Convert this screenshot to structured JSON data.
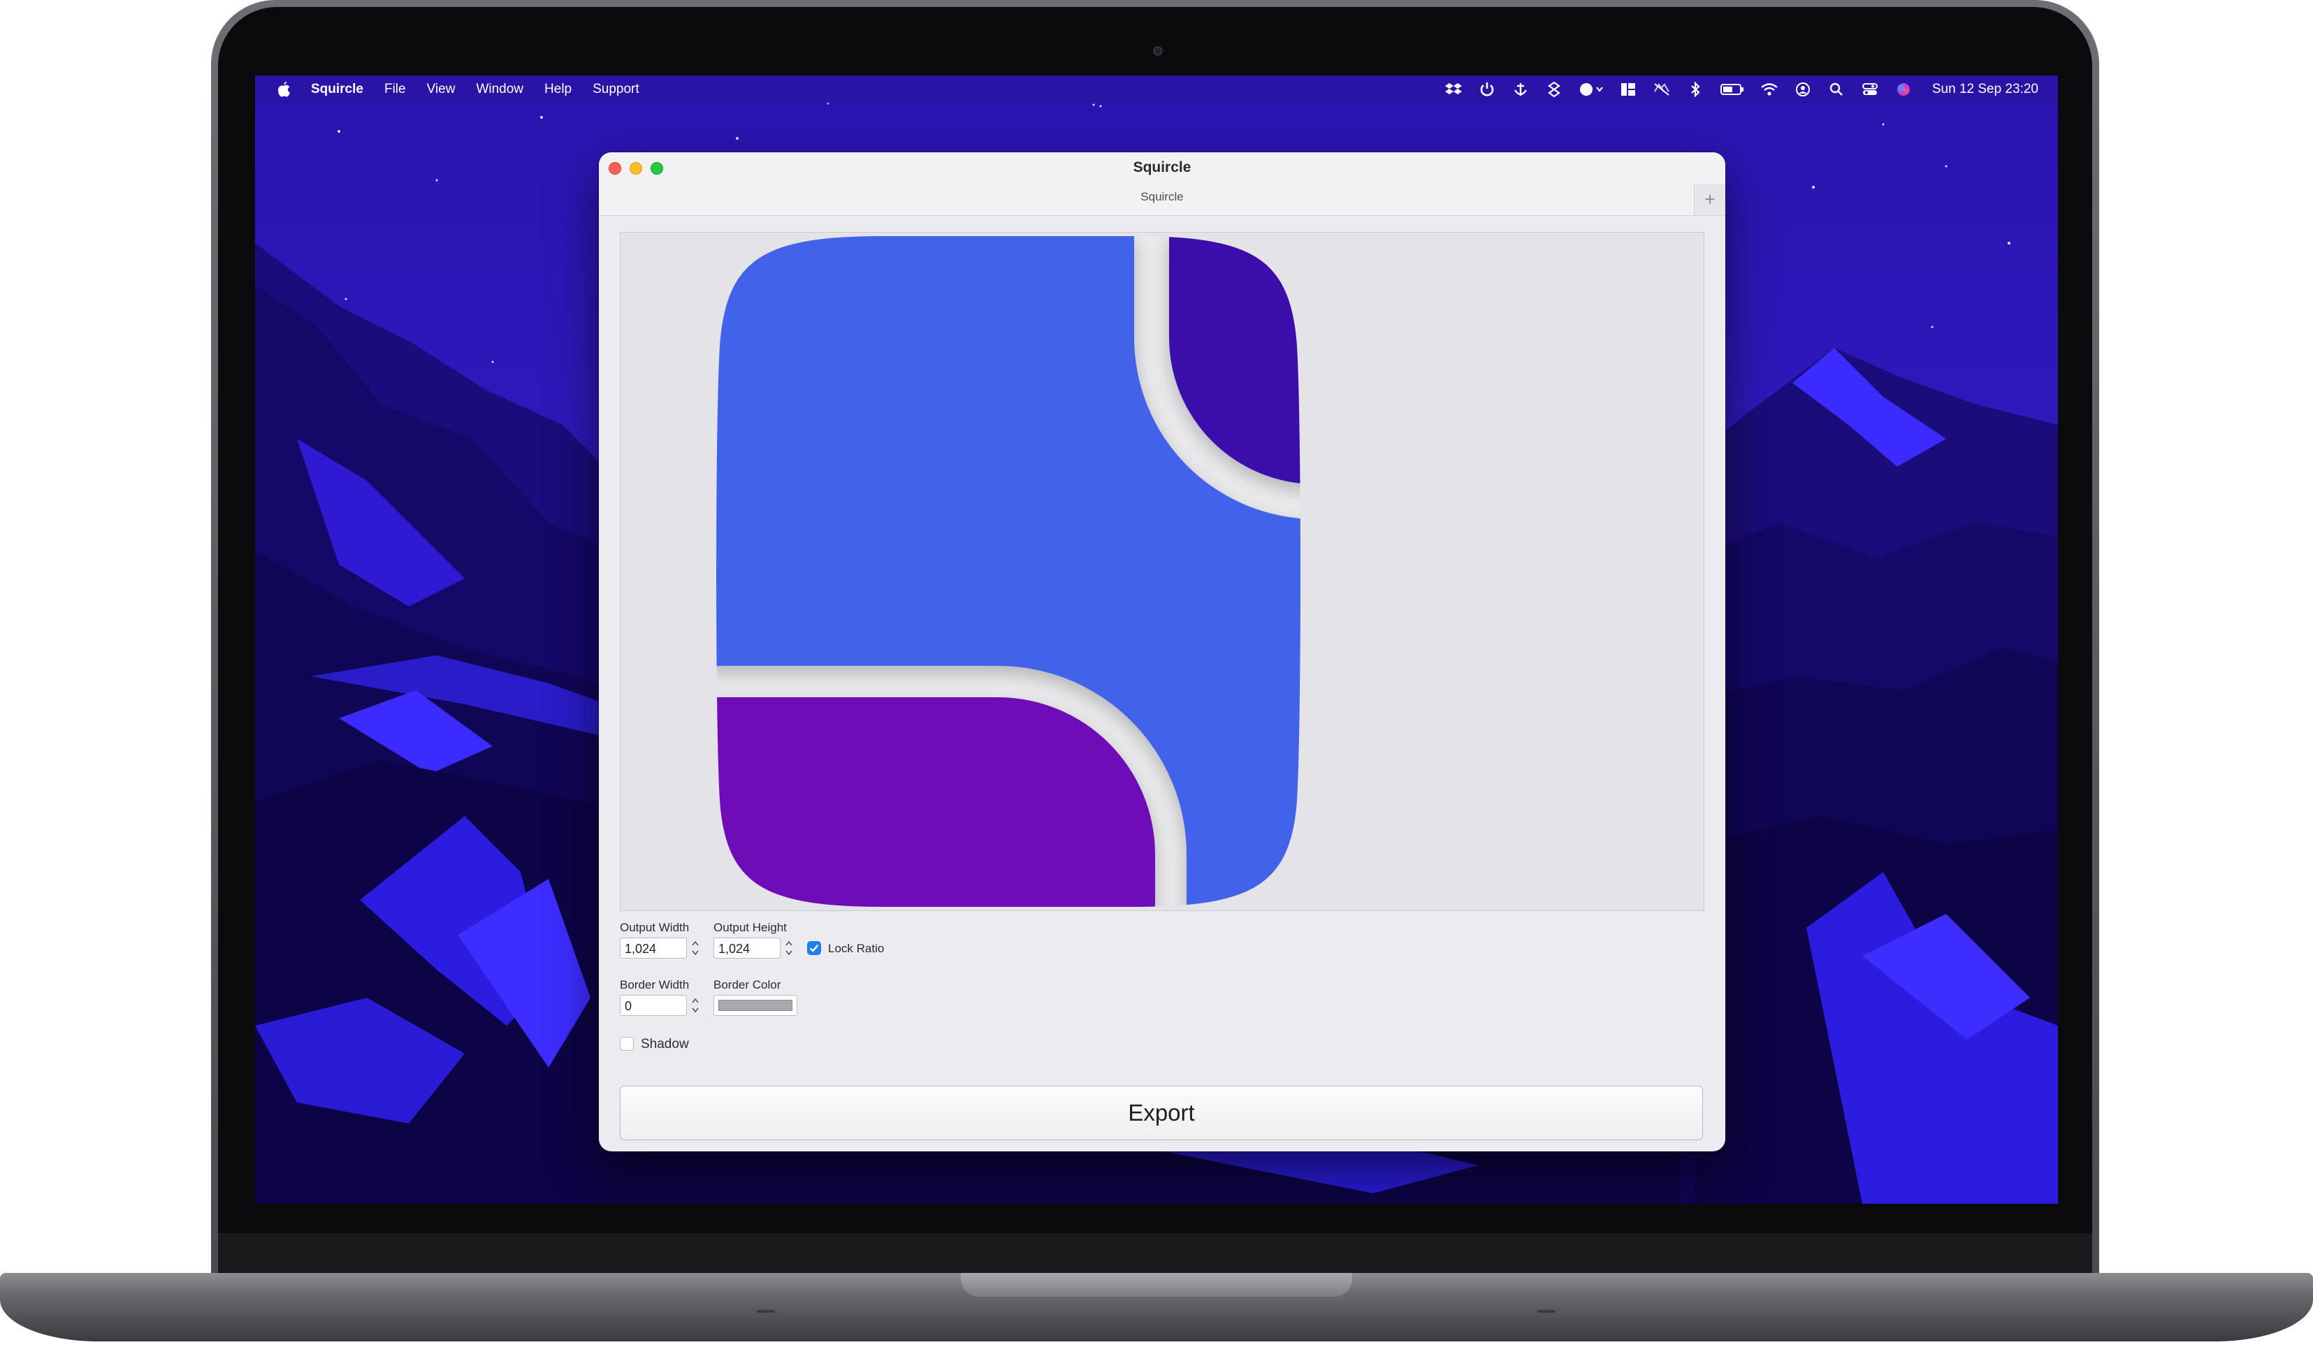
{
  "menubar": {
    "app_name": "Squircle",
    "menus": [
      "File",
      "View",
      "Window",
      "Help",
      "Support"
    ],
    "status_icons": [
      "dropbox-icon",
      "power-icon",
      "anchor-icon",
      "shield-icon",
      "toggle-icon",
      "layout-icon",
      "screen-mirror-icon",
      "bluetooth-icon",
      "battery-icon",
      "wifi-icon",
      "user-icon",
      "spotlight-icon",
      "control-center-icon",
      "siri-icon"
    ],
    "clock": "Sun 12 Sep  23:20"
  },
  "window": {
    "title": "Squircle",
    "tab_title": "Squircle",
    "tab_add_label": "+"
  },
  "preview": {
    "colors": {
      "background": "#e3e3e8",
      "tile_blue": "#4363e9",
      "tile_indigo": "#3b0cab",
      "tile_purple": "#6e0bb8",
      "gap": "#ececef"
    }
  },
  "controls": {
    "output_width_label": "Output Width",
    "output_width_value": "1,024",
    "output_height_label": "Output Height",
    "output_height_value": "1,024",
    "lock_ratio_label": "Lock Ratio",
    "lock_ratio_checked": true,
    "border_width_label": "Border Width",
    "border_width_value": "0",
    "border_color_label": "Border Color",
    "border_color_value": "#a9a9ad",
    "shadow_label": "Shadow",
    "shadow_checked": false
  },
  "export_button": {
    "label": "Export"
  },
  "theme": {
    "accent": "#1f7ef0",
    "wallpaper_primary": "#2d18b8",
    "wallpaper_highlight": "#3b2bff"
  }
}
